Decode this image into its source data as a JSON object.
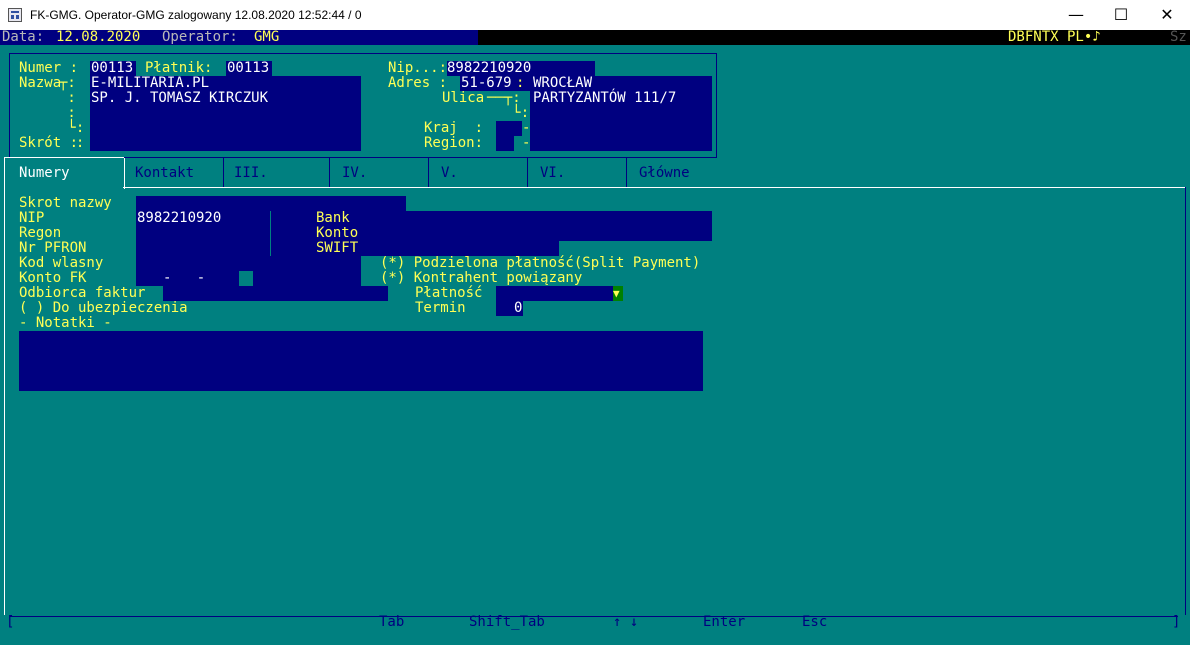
{
  "window": {
    "title": "FK-GMG. Operator-GMG zalogowany 12.08.2020 12:52:44 / 0",
    "minimize": "—",
    "maximize": "☐",
    "close": "✕"
  },
  "status": {
    "data_label": "Data:",
    "data_value": "12.08.2020",
    "operator_label": "Operator:",
    "operator_value": "GMG",
    "right": "DBFNTX PL•♪",
    "far_right": "Sz"
  },
  "header": {
    "numer_label": "Numer :",
    "numer_value": "00113",
    "platnik_label": "Płatnik:",
    "platnik_value": "00113",
    "nip_label": "Nip...:",
    "nip_value": "8982210920",
    "nazwa_label": "Nazwa",
    "nazwa_line1": "E-MILITARIA.PL",
    "nazwa_line2": "SP. J. TOMASZ KIRCZUK",
    "skrot_label": "Skrót :",
    "adres_label": "Adres :",
    "kod_pocztowy": "51-679",
    "miasto": "WROCŁAW",
    "ulica_label": "Ulica",
    "ulica_value": "PARTYZANTÓW 111/7",
    "kraj_label": "Kraj  :",
    "region_label": "Region:"
  },
  "tabs": [
    {
      "label": "Numery",
      "active": true
    },
    {
      "label": "Kontakt",
      "active": false
    },
    {
      "label": "III.",
      "active": false
    },
    {
      "label": "IV.",
      "active": false
    },
    {
      "label": "V.",
      "active": false
    },
    {
      "label": "VI.",
      "active": false
    },
    {
      "label": "Główne",
      "active": false
    }
  ],
  "numery": {
    "skrot_nazwy_label": "Skrot nazwy",
    "nip_label": "NIP",
    "nip_value": "8982210920",
    "regon_label": "Regon",
    "nr_pfron_label": "Nr PFRON",
    "kod_wlasny_label": "Kod wlasny",
    "konto_fk_label": "Konto FK",
    "konto_fk_value": "-   -",
    "odbiorca_label": "Odbiorca faktur",
    "ubezpieczenia_label": "( ) Do ubezpieczenia",
    "notatki_label": "- Notatki -",
    "bank_label": "Bank",
    "konto_label": "Konto",
    "swift_label": "SWIFT",
    "split_payment_label": "(*) Podzielona płatność(Split Payment)",
    "kontrahent_label": "(*) Kontrahent powiązany",
    "platnosc_label": "Płatność",
    "termin_label": "Termin",
    "termin_value": "0"
  },
  "bottom": {
    "left_bracket": "[",
    "right_bracket": "]",
    "keys": [
      "Tab",
      "Shift_Tab",
      "↑ ↓",
      "Enter",
      "Esc"
    ]
  }
}
